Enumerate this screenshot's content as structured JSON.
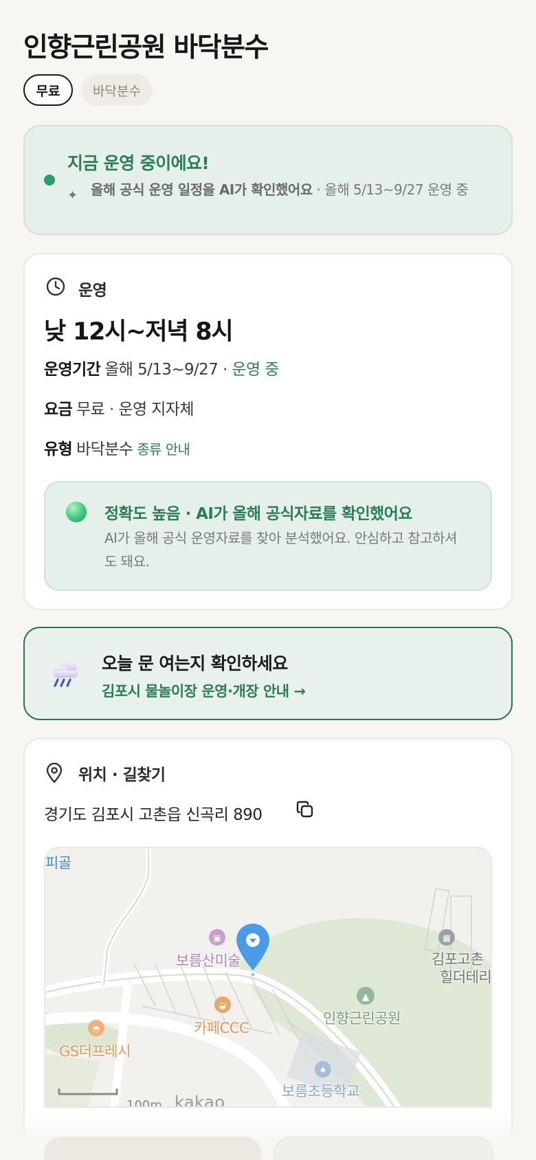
{
  "header": {
    "title": "인향근린공원 바닥분수",
    "chips": {
      "free": "무료",
      "type": "바닥분수"
    }
  },
  "status": {
    "title": "지금 운영 중이에요!",
    "desc_bold": "올해 공식 운영 일정을 AI가 확인했어요",
    "desc_rest": " · 올해 5/13~9/27 운영 중",
    "accent_color": "#2e9c68"
  },
  "operation": {
    "section_label": "운영",
    "hours": "낮 12시~저녁 8시",
    "period": {
      "key": "운영기간",
      "value": "올해 5/13~9/27 · ",
      "status": "운영 중"
    },
    "fee": {
      "key": "요금",
      "value": "무료 · 운영 지자체"
    },
    "type": {
      "key": "유형",
      "value": "바닥분수",
      "link": "종류 안내"
    },
    "accuracy": {
      "title": "정확도 높음 · AI가 올해 공식자료를 확인했어요",
      "desc": "AI가 올해 공식 운영자료를 찾아 분석했어요. 안심하고 참고하셔도 돼요."
    }
  },
  "open_check": {
    "title": "오늘 문 여는지 확인하세요",
    "link": "김포시 물놀이장 운영·개장 안내 →"
  },
  "location": {
    "section_label": "위치 · 길찾기",
    "address": "경기도 김포시 고촌읍 신곡리 890",
    "map": {
      "labels": {
        "corner": "피골",
        "museum": "보름산미술",
        "gokchon_1": "김포고촌",
        "gokchon_2": "힐더테리",
        "park": "인향근린공원",
        "cafe": "카페CCC",
        "gs": "GS더프레시",
        "school": "보름초등학교"
      },
      "scale": "100m",
      "provider": "kakao"
    }
  }
}
